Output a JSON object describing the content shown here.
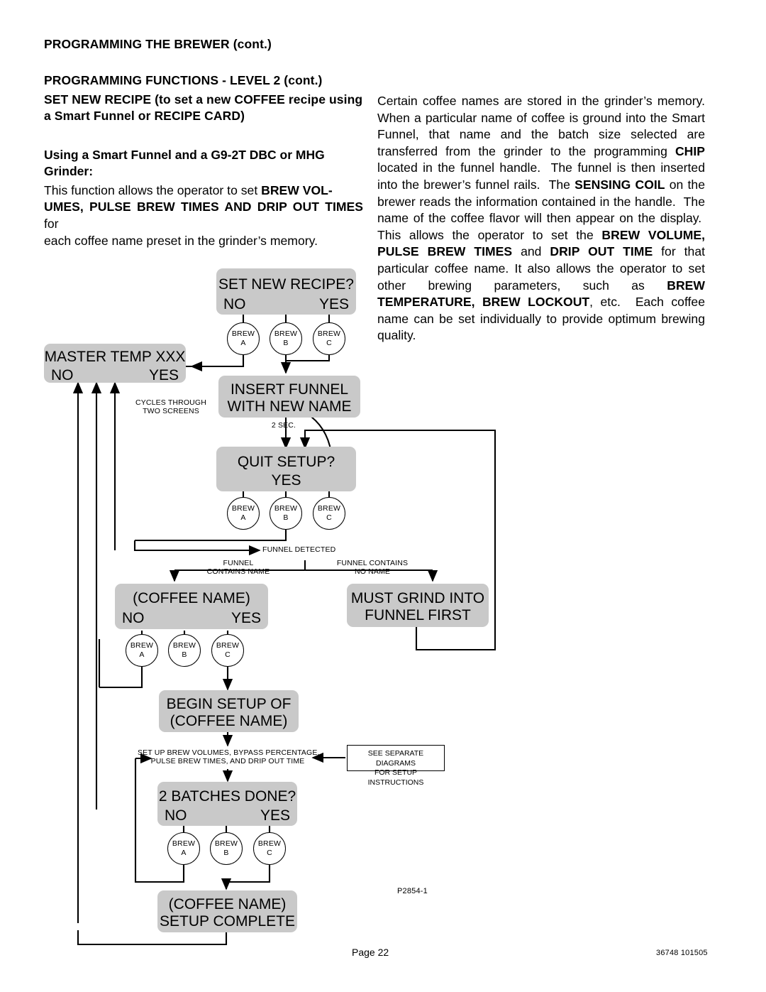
{
  "header": {
    "title": "PROGRAMMING THE BREWER (cont.)",
    "subtitle": "PROGRAMMING FUNCTIONS - LEVEL  2 (cont.)",
    "section_title_line1": "SET NEW RECIPE (to set a new COFFEE recipe using",
    "section_title_line2": "a Smart Funnel or RECIPE CARD)"
  },
  "left_column": {
    "subhead_line1": "Using a Smart Funnel and a G9-2T DBC or MHG",
    "subhead_line2": "Grinder:",
    "body_html": "This function allows the operator to set <b>BREW VOL-</b><br><b>UMES, PULSE BREW TIMES AND DRIP OUT TIMES</b> for<br>each coffee name preset in the grinder&rsquo;s memory."
  },
  "right_column": {
    "body_html": "Certain coffee names are stored in the grinder&rsquo;s memory. When a particular name of coffee is ground into the Smart Funnel, that name and the batch size selected are transferred from the grinder to the programming <b>CHIP</b> located in the funnel handle.&nbsp; The funnel is then inserted into the brewer&rsquo;s funnel rails.&nbsp; The <b>SENSING COIL</b> on the brewer reads the information contained in the handle.&nbsp; The name of the coffee flavor will then appear on the display.&nbsp; This allows the operator to set the <b>BREW VOLUME, PULSE BREW TIMES</b> and <b>DRIP OUT TIME</b> for that particular coffee name. It also allows the operator to set other brewing parameters, such as <b>BREW TEMPERATURE, BREW LOCKOUT</b>, etc.&nbsp; Each coffee name can be set individually to provide optimum brewing quality."
  },
  "flowchart": {
    "displays": [
      {
        "id": "set-new-recipe",
        "line1": "SET NEW RECIPE?",
        "no": "NO",
        "yes": "YES"
      },
      {
        "id": "master-temp",
        "line1": "MASTER TEMP XXX",
        "no": "NO",
        "yes": "YES"
      },
      {
        "id": "insert-funnel",
        "line1": "INSERT FUNNEL",
        "line2": "WITH NEW NAME"
      },
      {
        "id": "quit-setup",
        "line1": "QUIT SETUP?",
        "line2": "YES"
      },
      {
        "id": "coffee-name",
        "line1": "(COFFEE NAME)",
        "no": "NO",
        "yes": "YES"
      },
      {
        "id": "must-grind",
        "line1": "MUST GRIND INTO",
        "line2": "FUNNEL FIRST"
      },
      {
        "id": "begin-setup",
        "line1": "BEGIN SETUP OF",
        "line2": "(COFFEE NAME)"
      },
      {
        "id": "batches-done",
        "line1": "2 BATCHES DONE?",
        "no": "NO",
        "yes": "YES"
      },
      {
        "id": "setup-complete",
        "line1": "(COFFEE NAME)",
        "line2": "SETUP COMPLETE"
      }
    ],
    "brew_buttons": {
      "a_top": "BREW",
      "a_bot": "A",
      "b_top": "BREW",
      "b_bot": "B",
      "c_top": "BREW",
      "c_bot": "C"
    },
    "annotations": {
      "cycles_line1": "CYCLES THROUGH",
      "cycles_line2": "TWO SCREENS",
      "two_sec": "2 SEC.",
      "funnel_detected": "FUNNEL DETECTED",
      "contains_name_l1": "FUNNEL",
      "contains_name_l2": "CONTAINS NAME",
      "no_name_l1": "FUNNEL CONTAINS",
      "no_name_l2": "NO NAME",
      "setup_steps_l1": "SET UP BREW VOLUMES, BYPASS PERCENTAGE,",
      "setup_steps_l2": "PULSE BREW TIMES, AND DRIP OUT TIME",
      "see_diagrams_l1": "SEE SEPARATE DIAGRAMS",
      "see_diagrams_l2": "FOR SETUP INSTRUCTIONS",
      "drawing_number": "P2854-1"
    }
  },
  "footer": {
    "page": "Page 22",
    "doc_number": "36748 101505"
  },
  "colors": {
    "display_fill": "#c9c9c9",
    "line": "#000000",
    "page_background": "#ffffff"
  }
}
